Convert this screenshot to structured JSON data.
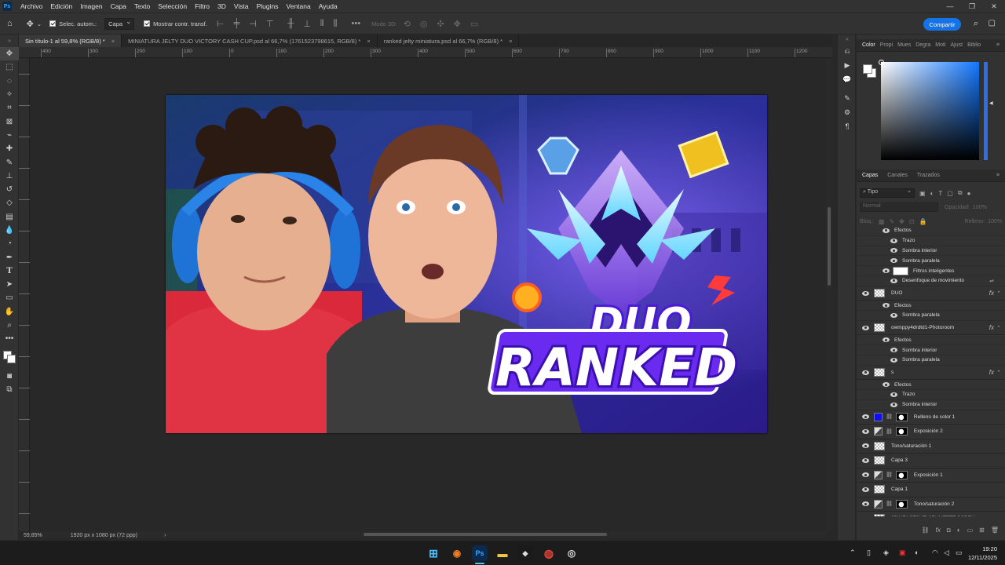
{
  "app": {
    "logo": "Ps",
    "menu": [
      "Archivo",
      "Edición",
      "Imagen",
      "Capa",
      "Texto",
      "Selección",
      "Filtro",
      "3D",
      "Vista",
      "Plugins",
      "Ventana",
      "Ayuda"
    ]
  },
  "options_bar": {
    "auto_select_label": "Selec. autom.:",
    "auto_select_value": "Capa",
    "show_transform_label": "Mostrar contr. transf.",
    "mode_3d_label": "Modo 3D:",
    "share_label": "Compartir"
  },
  "tabs": [
    {
      "label": "Sin título-1 al 59,8% (RGB/8) *",
      "active": true
    },
    {
      "label": "MINIATURA JELTY DUO VICTORY CASH CUP.psd al 66,7% (1761523798615, RGB/8) *",
      "active": false
    },
    {
      "label": "ranked jelty miniatura.psd al 66,7% (RGB/8) *",
      "active": false
    }
  ],
  "ruler_ticks": [
    "400",
    "300",
    "200",
    "100",
    "0",
    "100",
    "200",
    "300",
    "400",
    "500",
    "600",
    "700",
    "800",
    "900",
    "1000",
    "1100",
    "1200",
    "1300",
    "1400",
    "1500",
    "1600",
    "1700",
    "1800",
    "1900",
    "2000",
    "2100"
  ],
  "status": {
    "zoom": "59,85%",
    "doc_info": "1920 px x 1080 px (72 ppp)"
  },
  "artwork": {
    "line1": "DUO",
    "line2": "RANKED"
  },
  "color_panel": {
    "tabs": [
      "Color",
      "Propi",
      "Mues",
      "Degra",
      "Moti",
      "Ajust",
      "Biblio"
    ],
    "fg_color": "#ffffff",
    "bg_color": "#ffffff",
    "hue_color": "#1277ff"
  },
  "layers_panel": {
    "tabs": [
      "Capas",
      "Canales",
      "Trazados"
    ],
    "kind_filter": "Tipo",
    "blend_mode": "Normal",
    "opacity_label": "Opacidad:",
    "opacity_value": "100%",
    "lock_label": "Bloq.:",
    "fill_label": "Relleno:",
    "fill_value": "100%",
    "rows": [
      {
        "type": "fx",
        "indent": 1,
        "label": "Efectos"
      },
      {
        "type": "fx",
        "indent": 2,
        "label": "Trazo"
      },
      {
        "type": "fx",
        "indent": 2,
        "label": "Sombra interior"
      },
      {
        "type": "fx",
        "indent": 2,
        "label": "Sombra paralela"
      },
      {
        "type": "smart",
        "indent": 1,
        "label": "Filtros inteligentes"
      },
      {
        "type": "fx",
        "indent": 2,
        "label": "Desenfoque de movimiento"
      },
      {
        "type": "layer",
        "label": "DUO",
        "fx": true
      },
      {
        "type": "fx",
        "indent": 1,
        "label": "Efectos"
      },
      {
        "type": "fx",
        "indent": 2,
        "label": "Sombra paralela"
      },
      {
        "type": "layer",
        "label": "owmppy4drdtd1-Photoroom",
        "fx": true
      },
      {
        "type": "fx",
        "indent": 1,
        "label": "Efectos"
      },
      {
        "type": "fx",
        "indent": 2,
        "label": "Sombra interior"
      },
      {
        "type": "fx",
        "indent": 2,
        "label": "Sombra paralela"
      },
      {
        "type": "layer",
        "label": "s",
        "fx": true
      },
      {
        "type": "fx",
        "indent": 1,
        "label": "Efectos"
      },
      {
        "type": "fx",
        "indent": 2,
        "label": "Trazo"
      },
      {
        "type": "fx",
        "indent": 2,
        "label": "Sombra interior"
      },
      {
        "type": "adj",
        "label": "Relleno de color 1",
        "swatch": "#1010ee"
      },
      {
        "type": "adj",
        "label": "Exposición 2"
      },
      {
        "type": "layer",
        "label": "Tono/saturación 1"
      },
      {
        "type": "layer",
        "label": "Capa 3"
      },
      {
        "type": "adj",
        "label": "Exposición 1"
      },
      {
        "type": "layer",
        "label": "Capa 1"
      },
      {
        "type": "adj",
        "label": "Tono/saturación 2"
      },
      {
        "type": "layer",
        "label": "2BINZAGT9NEL3PUMT7ET GSDRY"
      }
    ]
  },
  "taskbar": {
    "time": "19:20",
    "date": "12/11/2025"
  }
}
